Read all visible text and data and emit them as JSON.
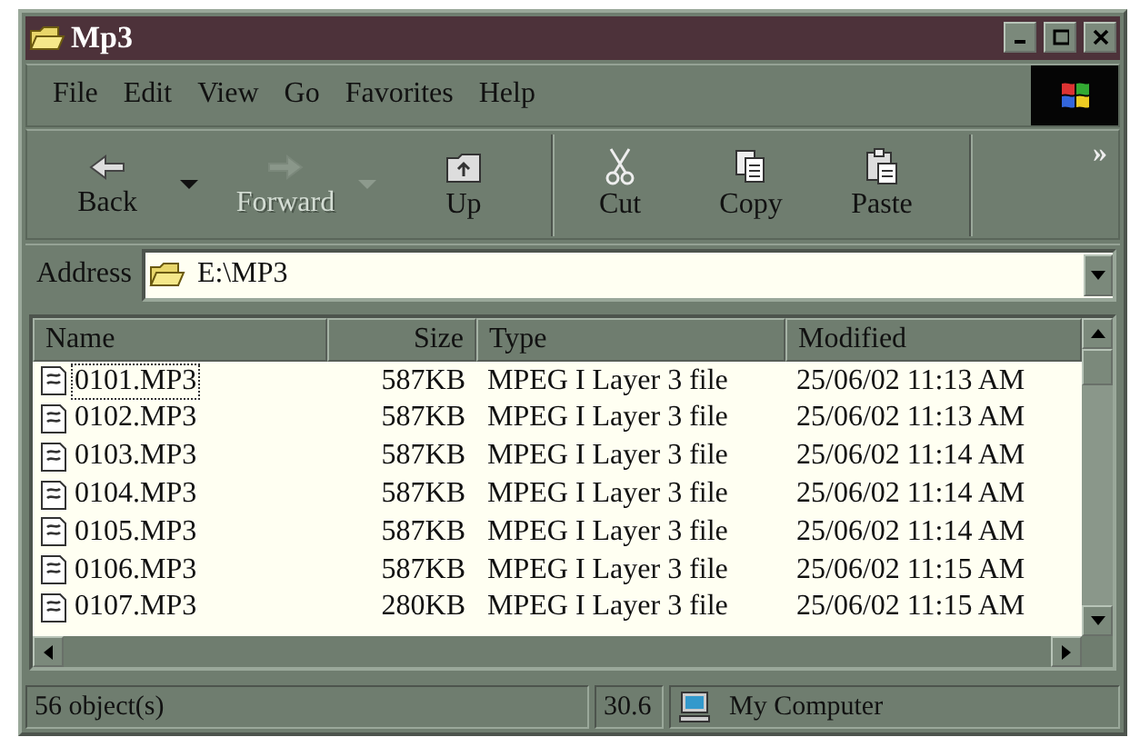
{
  "window": {
    "title": "Mp3"
  },
  "menu": [
    {
      "label": "File"
    },
    {
      "label": "Edit"
    },
    {
      "label": "View"
    },
    {
      "label": "Go"
    },
    {
      "label": "Favorites"
    },
    {
      "label": "Help"
    }
  ],
  "toolbar": {
    "groups": [
      [
        {
          "kind": "back",
          "label": "Back",
          "disabled": false,
          "dropdown": true
        },
        {
          "kind": "forward",
          "label": "Forward",
          "disabled": true,
          "dropdown": true
        },
        {
          "kind": "up",
          "label": "Up",
          "disabled": false,
          "dropdown": false
        }
      ],
      [
        {
          "kind": "cut",
          "label": "Cut",
          "disabled": false,
          "dropdown": false
        },
        {
          "kind": "copy",
          "label": "Copy",
          "disabled": false,
          "dropdown": false
        },
        {
          "kind": "paste",
          "label": "Paste",
          "disabled": false,
          "dropdown": false
        }
      ]
    ],
    "overflow": "»"
  },
  "address": {
    "label": "Address",
    "value": "E:\\MP3"
  },
  "table": {
    "columns": [
      {
        "label": "Name"
      },
      {
        "label": "Size"
      },
      {
        "label": "Type"
      },
      {
        "label": "Modified"
      }
    ],
    "rows": [
      {
        "cells": [
          "0101.MP3",
          "587KB",
          "MPEG I Layer 3 file",
          "25/06/02 11:13 AM"
        ],
        "focused": true
      },
      {
        "cells": [
          "0102.MP3",
          "587KB",
          "MPEG I Layer 3 file",
          "25/06/02 11:13 AM"
        ],
        "focused": false
      },
      {
        "cells": [
          "0103.MP3",
          "587KB",
          "MPEG I Layer 3 file",
          "25/06/02 11:14 AM"
        ],
        "focused": false
      },
      {
        "cells": [
          "0104.MP3",
          "587KB",
          "MPEG I Layer 3 file",
          "25/06/02 11:14 AM"
        ],
        "focused": false
      },
      {
        "cells": [
          "0105.MP3",
          "587KB",
          "MPEG I Layer 3 file",
          "25/06/02 11:14 AM"
        ],
        "focused": false
      },
      {
        "cells": [
          "0106.MP3",
          "587KB",
          "MPEG I Layer 3 file",
          "25/06/02 11:15 AM"
        ],
        "focused": false
      },
      {
        "cells": [
          "0107.MP3",
          "280KB",
          "MPEG I Layer 3 file",
          "25/06/02 11:15 AM"
        ],
        "focused": false
      }
    ]
  },
  "status_bar": {
    "objects": "56 object(s)",
    "size": "30.6",
    "zone": "My Computer"
  }
}
